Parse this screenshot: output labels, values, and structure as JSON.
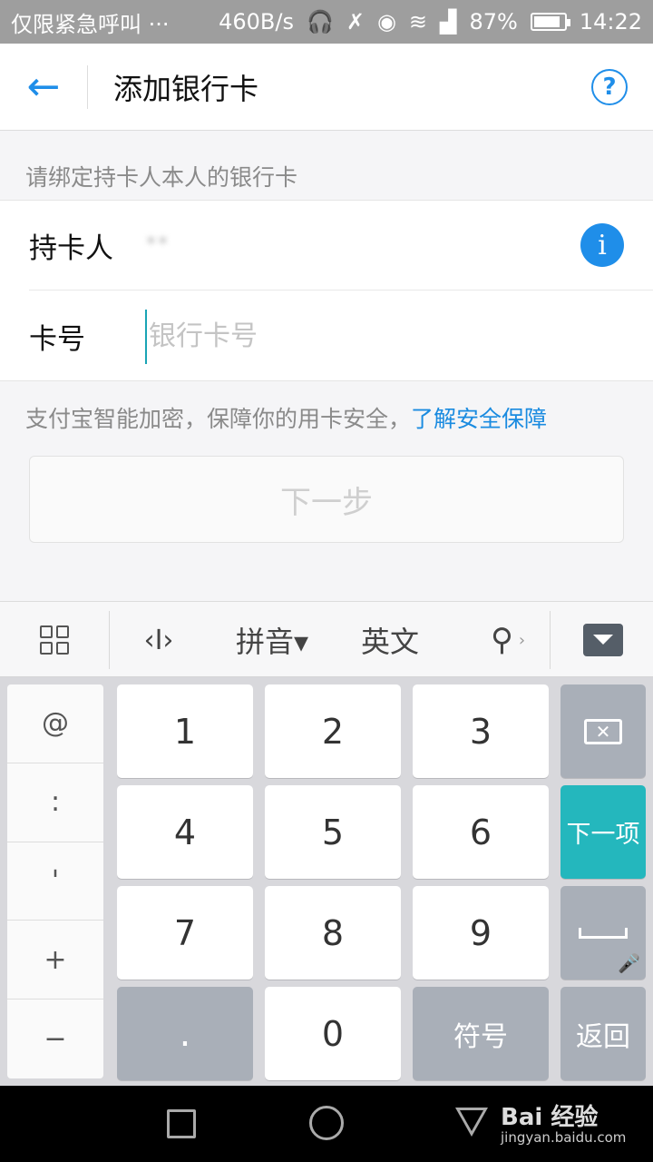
{
  "status_bar": {
    "carrier": "仅限紧急呼叫 ···",
    "speed": "460B/s",
    "battery": "87%",
    "battery_level": 0.87,
    "time": "14:22"
  },
  "header": {
    "title": "添加银行卡"
  },
  "form": {
    "hint": "请绑定持卡人本人的银行卡",
    "holder_label": "持卡人",
    "holder_name": "**",
    "card_label": "卡号",
    "card_placeholder": "银行卡号",
    "card_value": ""
  },
  "security": {
    "text": "支付宝智能加密，保障你的用卡安全，",
    "link": "了解安全保障"
  },
  "next_button": "下一步",
  "keyboard_bar": {
    "pinyin": "拼音▾",
    "english": "英文"
  },
  "keyboard": {
    "side_keys": [
      "@",
      ":",
      "'",
      "+",
      "−"
    ],
    "digits": [
      "1",
      "2",
      "3",
      "4",
      "5",
      "6",
      "7",
      "8",
      "9"
    ],
    "dot": ".",
    "zero": "0",
    "symbols": "符号",
    "next_field": "下一项",
    "return": "返回"
  },
  "watermark": {
    "brand": "Bai 经验",
    "url": "jingyan.baidu.com"
  }
}
